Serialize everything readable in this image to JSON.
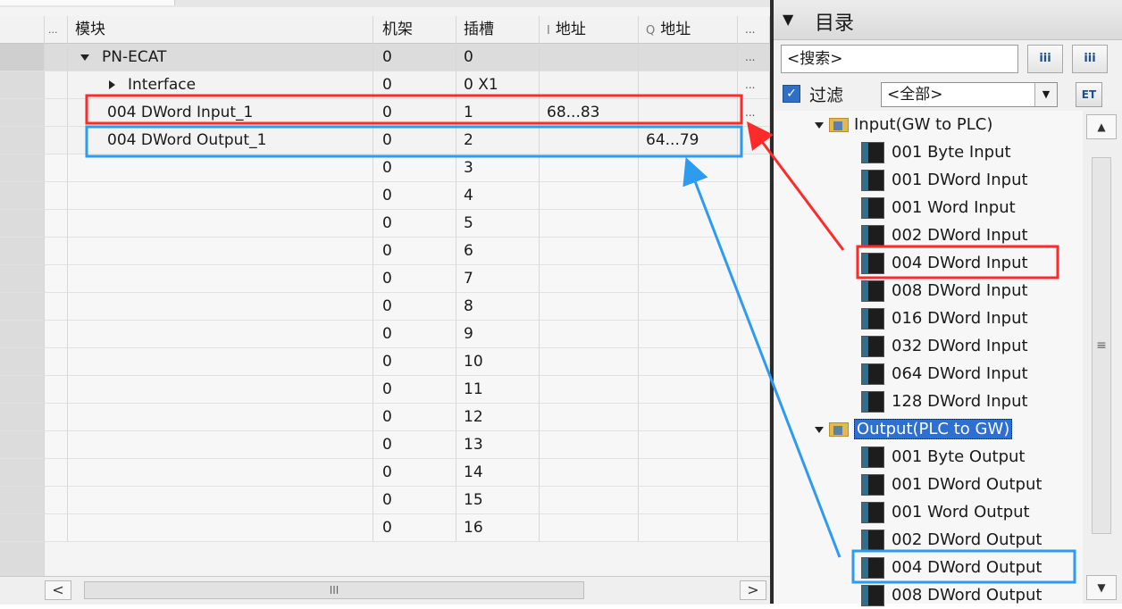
{
  "device_view": {
    "columns": {
      "module": "模块",
      "rack": "机架",
      "slot": "插槽",
      "i_address": "地址",
      "q_address": "地址",
      "i_prefix": "I",
      "q_prefix": "Q",
      "more": "..."
    },
    "rows": [
      {
        "module": "PN-ECAT",
        "rack": "0",
        "slot": "0",
        "i_addr": "",
        "q_addr": "",
        "more": "..."
      },
      {
        "module": "Interface",
        "rack": "0",
        "slot": "0 X1",
        "i_addr": "",
        "q_addr": "",
        "more": "..."
      },
      {
        "module": "004 DWord Input_1",
        "rack": "0",
        "slot": "1",
        "i_addr": "68...83",
        "q_addr": "",
        "more": "..."
      },
      {
        "module": "004 DWord Output_1",
        "rack": "0",
        "slot": "2",
        "i_addr": "",
        "q_addr": "64...79",
        "more": ""
      },
      {
        "module": "",
        "rack": "0",
        "slot": "3"
      },
      {
        "module": "",
        "rack": "0",
        "slot": "4"
      },
      {
        "module": "",
        "rack": "0",
        "slot": "5"
      },
      {
        "module": "",
        "rack": "0",
        "slot": "6"
      },
      {
        "module": "",
        "rack": "0",
        "slot": "7"
      },
      {
        "module": "",
        "rack": "0",
        "slot": "8"
      },
      {
        "module": "",
        "rack": "0",
        "slot": "9"
      },
      {
        "module": "",
        "rack": "0",
        "slot": "10"
      },
      {
        "module": "",
        "rack": "0",
        "slot": "11"
      },
      {
        "module": "",
        "rack": "0",
        "slot": "12"
      },
      {
        "module": "",
        "rack": "0",
        "slot": "13"
      },
      {
        "module": "",
        "rack": "0",
        "slot": "14"
      },
      {
        "module": "",
        "rack": "0",
        "slot": "15"
      },
      {
        "module": "",
        "rack": "0",
        "slot": "16"
      }
    ],
    "scroll_left": "<",
    "scroll_right": ">",
    "scroll_grip": "III"
  },
  "catalog": {
    "title": "目录",
    "collapse_icon": "chevron-down-icon",
    "search_placeholder": "<搜索>",
    "search_btn1": "iii",
    "search_btn2": "iii",
    "filter_checked": true,
    "filter_label": "过滤",
    "filter_value": "<全部>",
    "folders": [
      {
        "label": "Input(GW to PLC)",
        "items": [
          "001 Byte Input",
          "001 DWord Input",
          "001 Word Input",
          "002 DWord Input",
          "004 DWord Input",
          "008 DWord Input",
          "016 DWord Input",
          "032 DWord Input",
          "064 DWord Input",
          "128 DWord Input"
        ]
      },
      {
        "label": "Output(PLC to GW)",
        "items": [
          "001 Byte Output",
          "001 DWord Output",
          "001 Word Output",
          "002 DWord Output",
          "004 DWord Output",
          "008 DWord Output"
        ]
      }
    ],
    "scroll_grip": "≡"
  },
  "colors": {
    "red_highlight": "#ff2a2a",
    "blue_highlight": "#2d9bf0",
    "selection": "#2f6fd1"
  }
}
